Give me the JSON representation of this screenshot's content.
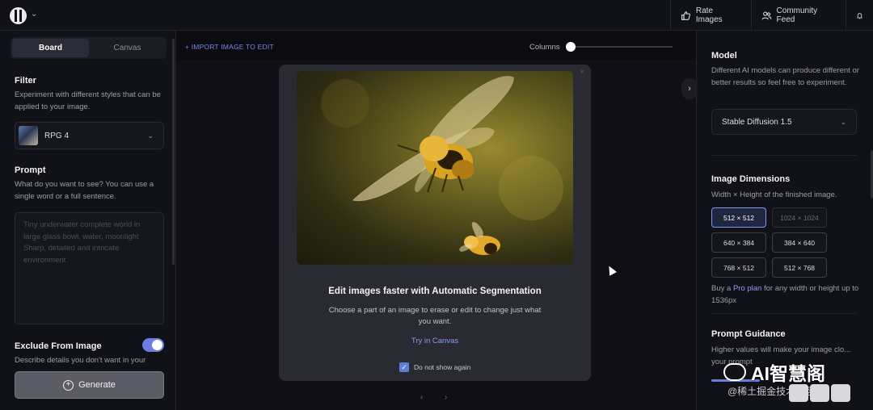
{
  "topbar": {
    "rate_label": "Rate Images",
    "community_label": "Community Feed"
  },
  "left": {
    "tabs": [
      "Board",
      "Canvas"
    ],
    "filter": {
      "title": "Filter",
      "desc": "Experiment with different styles that can be applied to your image.",
      "value": "RPG 4"
    },
    "prompt": {
      "title": "Prompt",
      "desc": "What do you want to see? You can use a single word or a full sentence.",
      "placeholder": "Tiny underwater complete world in large glass bowl, water, moonlight Sharp, detailed and intricate environment"
    },
    "exclude": {
      "title": "Exclude From Image",
      "desc": "Describe details you don't want in your",
      "enabled": true
    },
    "generate_label": "Generate"
  },
  "center": {
    "import_label": "+ IMPORT IMAGE TO EDIT",
    "columns_label": "Columns",
    "modal": {
      "close": "×",
      "title": "Edit images faster with Automatic Segmentation",
      "desc": "Choose a part of an image to erase or edit to change just what you want.",
      "link": "Try in Canvas",
      "checkbox_label": "Do not show again",
      "checked": true
    },
    "pager": {
      "prev": "‹",
      "next": "›"
    },
    "expand": "›"
  },
  "right": {
    "model": {
      "title": "Model",
      "desc": "Different AI models can produce different or better results so feel free to experiment.",
      "value": "Stable Diffusion 1.5"
    },
    "dimensions": {
      "title": "Image Dimensions",
      "desc": "Width × Height of the finished image.",
      "options": [
        "512 × 512",
        "1024 × 1024",
        "640 × 384",
        "384 × 640",
        "768 × 512",
        "512 × 768"
      ],
      "selected": "512 × 512",
      "disabled": [
        "1024 × 1024"
      ],
      "pro_prefix": "Buy a ",
      "pro_link": "Pro plan",
      "pro_suffix": " for any width or height up to 1536px"
    },
    "guidance": {
      "title": "Prompt Guidance",
      "desc": "Higher values will make your image clo... your prompt"
    }
  },
  "watermark": {
    "name": "AI智慧阁",
    "sub": "@稀土掘金技术社区"
  },
  "colors": {
    "accent": "#6b7de2",
    "link": "#8f9cf4",
    "background": "#0c0c12",
    "panel": "#111118"
  }
}
